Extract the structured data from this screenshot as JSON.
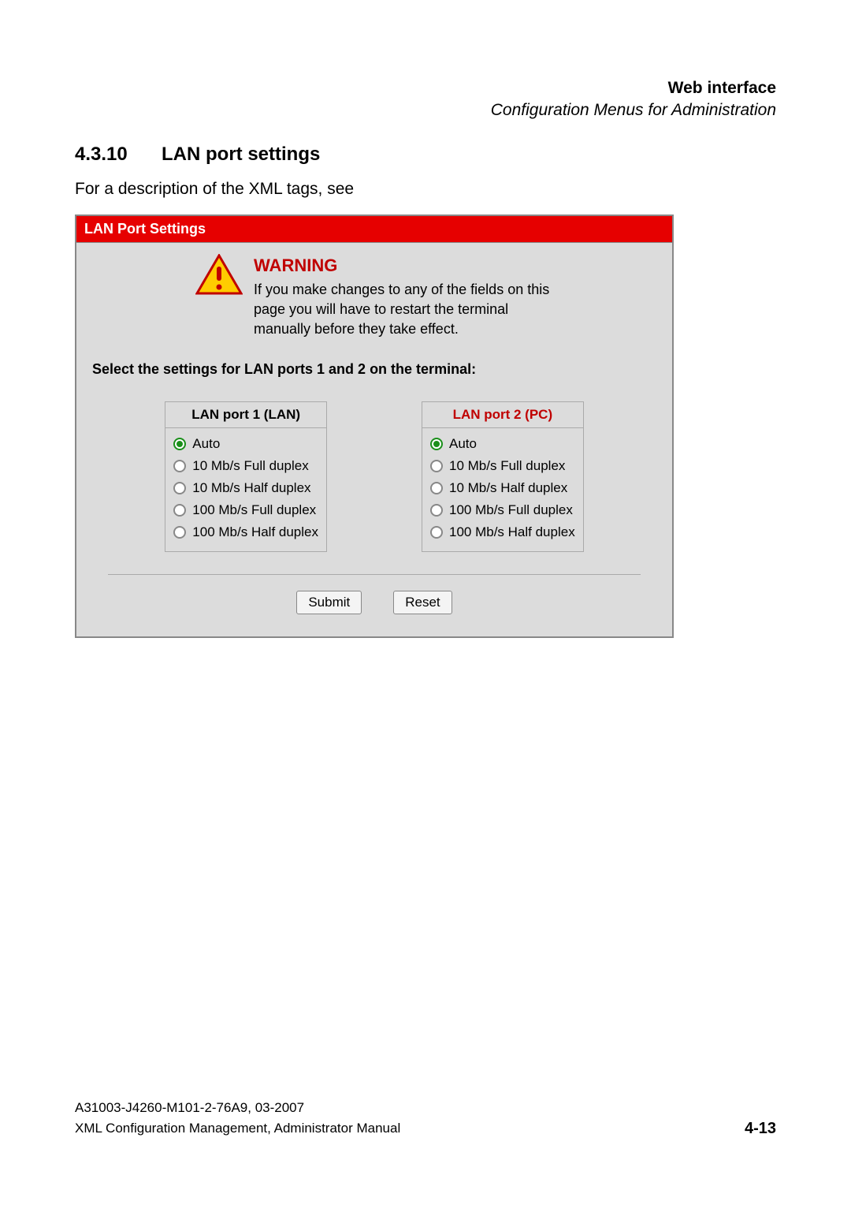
{
  "header": {
    "title": "Web interface",
    "subtitle": "Configuration Menus for Administration"
  },
  "section": {
    "number": "4.3.10",
    "title": "LAN port settings"
  },
  "intro": "For a description of the XML tags, see",
  "panel": {
    "title": "LAN Port Settings",
    "warning": {
      "label": "WARNING",
      "text": "If you make changes to any of the fields on this page you will have to restart the terminal manually before they take effect."
    },
    "instruction": "Select the settings for LAN ports 1 and 2 on the terminal:",
    "port1": {
      "title": "LAN port 1 (LAN)",
      "options": [
        "Auto",
        "10 Mb/s Full duplex",
        "10 Mb/s Half duplex",
        "100 Mb/s Full duplex",
        "100 Mb/s Half duplex"
      ]
    },
    "port2": {
      "title": "LAN port 2 (PC)",
      "options": [
        "Auto",
        "10 Mb/s Full duplex",
        "10 Mb/s Half duplex",
        "100 Mb/s Full duplex",
        "100 Mb/s Half duplex"
      ]
    },
    "buttons": {
      "submit": "Submit",
      "reset": "Reset"
    }
  },
  "footer": {
    "line1": "A31003-J4260-M101-2-76A9, 03-2007",
    "line2": "XML Configuration Management, Administrator Manual",
    "page": "4-13"
  }
}
